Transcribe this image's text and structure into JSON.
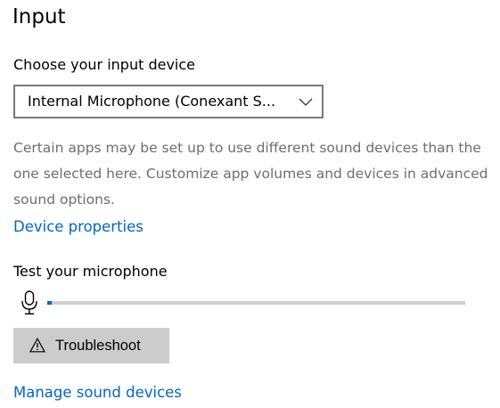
{
  "section": {
    "title": "Input"
  },
  "input_device": {
    "label": "Choose your input device",
    "selected_value": "Internal Microphone (Conexant S...",
    "chevron_icon": "chevron-down-icon"
  },
  "description": "Certain apps may be set up to use different sound devices than the one selected here. Customize app volumes and devices in advanced sound options.",
  "links": {
    "device_properties": "Device properties",
    "manage_sound_devices": "Manage sound devices"
  },
  "test": {
    "label": "Test your microphone",
    "icon": "microphone-icon",
    "level_fraction": 0.01
  },
  "troubleshoot": {
    "label": "Troubleshoot",
    "icon": "warning-icon"
  },
  "colors": {
    "accent": "#0067c0",
    "muted_text": "#6e6e6e",
    "button_bg": "#cccccc",
    "track": "#cfcfcf"
  }
}
